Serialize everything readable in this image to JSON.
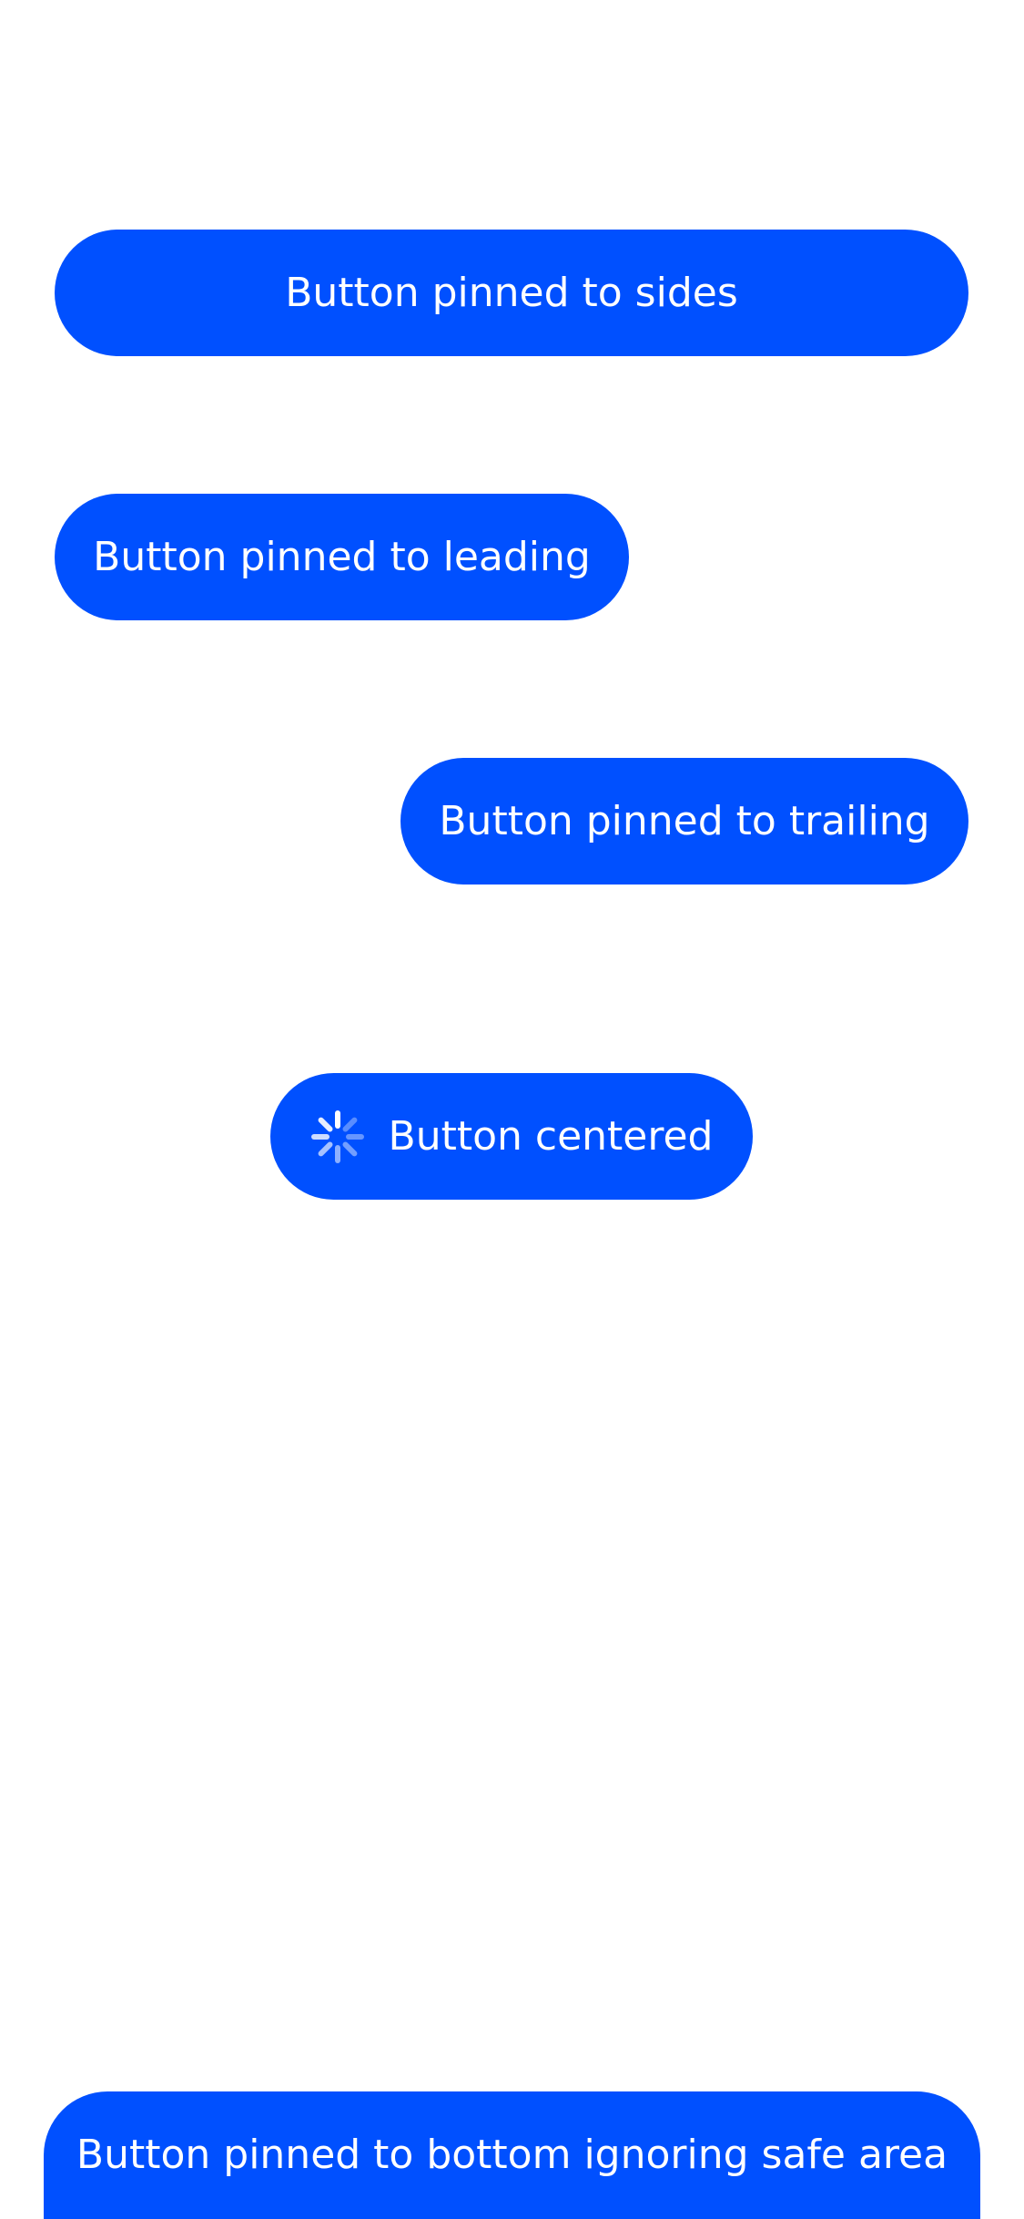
{
  "buttons": {
    "pinned_sides": {
      "label": "Button pinned to sides"
    },
    "pinned_leading": {
      "label": "Button pinned to leading"
    },
    "pinned_trailing": {
      "label": "Button pinned to trailing"
    },
    "centered": {
      "label": "Button centered",
      "icon": "loading-spinner-icon"
    },
    "pinned_bottom": {
      "label": "Button pinned to bottom ignoring safe area"
    }
  },
  "colors": {
    "button_background": "#0050ff",
    "button_text": "#ffffff",
    "page_background": "#ffffff"
  }
}
